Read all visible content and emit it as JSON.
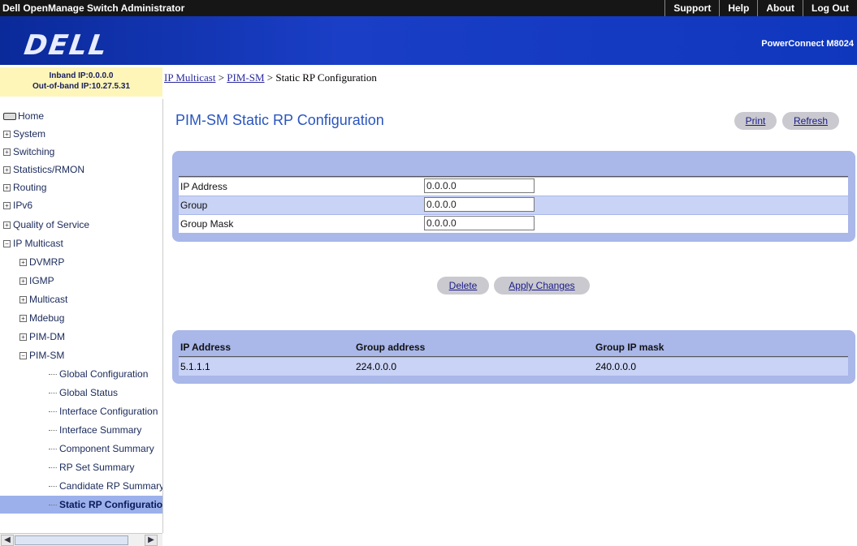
{
  "app": {
    "title": "Dell OpenManage Switch Administrator",
    "nav": [
      "Support",
      "Help",
      "About",
      "Log Out"
    ],
    "logo": "DELL",
    "model": "PowerConnect M8024"
  },
  "ipinfo": {
    "inband": "Inband IP:0.0.0.0",
    "outband": "Out-of-band IP:10.27.5.31"
  },
  "sidebar": {
    "items": [
      {
        "label": "Home",
        "kind": "home"
      },
      {
        "label": "System",
        "kind": "plus"
      },
      {
        "label": "Switching",
        "kind": "plus"
      },
      {
        "label": "Statistics/RMON",
        "kind": "plus"
      },
      {
        "label": "Routing",
        "kind": "plus"
      },
      {
        "label": "IPv6",
        "kind": "plus"
      },
      {
        "label": "Quality of Service",
        "kind": "plus"
      },
      {
        "label": "IP Multicast",
        "kind": "minus"
      },
      {
        "label": "DVMRP",
        "kind": "plus"
      },
      {
        "label": "IGMP",
        "kind": "plus"
      },
      {
        "label": "Multicast",
        "kind": "plus"
      },
      {
        "label": "Mdebug",
        "kind": "plus"
      },
      {
        "label": "PIM-DM",
        "kind": "plus"
      },
      {
        "label": "PIM-SM",
        "kind": "minus"
      },
      {
        "label": "Global Configuration",
        "kind": "leaf"
      },
      {
        "label": "Global Status",
        "kind": "leaf"
      },
      {
        "label": "Interface Configuration",
        "kind": "leaf"
      },
      {
        "label": "Interface Summary",
        "kind": "leaf"
      },
      {
        "label": "Component Summary",
        "kind": "leaf"
      },
      {
        "label": "RP Set Summary",
        "kind": "leaf"
      },
      {
        "label": "Candidate RP Summary",
        "kind": "leaf"
      },
      {
        "label": "Static RP Configuration",
        "kind": "leaf-active"
      }
    ]
  },
  "breadcrumb": {
    "part1": "IP Multicast",
    "sep1": " > ",
    "part2": "PIM-SM",
    "sep2": " > ",
    "part3": "Static RP Configuration"
  },
  "page": {
    "title": "PIM-SM Static RP Configuration",
    "print_label": "Print",
    "refresh_label": "Refresh"
  },
  "form": {
    "ip_address_label": "IP Address",
    "ip_address_value": "0.0.0.0",
    "group_label": "Group",
    "group_value": "0.0.0.0",
    "group_mask_label": "Group Mask",
    "group_mask_value": "0.0.0.0"
  },
  "actions": {
    "delete_label": "Delete",
    "apply_label": "Apply Changes"
  },
  "table": {
    "headers": [
      "IP Address",
      "Group address",
      "Group IP mask"
    ],
    "rows": [
      [
        "5.1.1.1",
        "224.0.0.0",
        "240.0.0.0"
      ]
    ]
  }
}
